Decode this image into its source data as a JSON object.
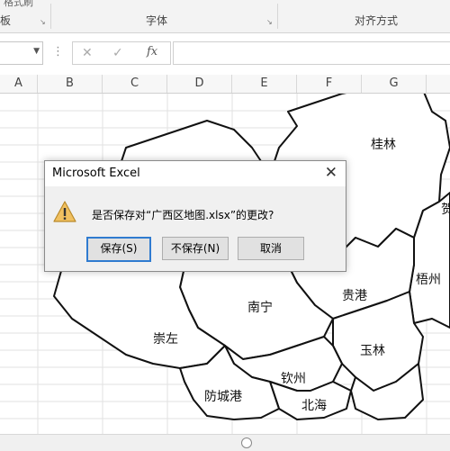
{
  "ribbon": {
    "cut_label": "格式刷",
    "group_left": "板",
    "group_font": "字体",
    "group_align": "对齐方式"
  },
  "formula_bar": {
    "cancel_icon": "✕",
    "enter_icon": "✓",
    "fx_label": "fx",
    "value": ""
  },
  "columns": [
    "A",
    "B",
    "C",
    "D",
    "E",
    "F",
    "G"
  ],
  "map": {
    "regions": [
      "桂林",
      "梧州",
      "贵港",
      "玉林",
      "南宁",
      "崇左",
      "钦州",
      "北海",
      "防城港",
      "贺"
    ]
  },
  "dialog": {
    "title": "Microsoft Excel",
    "close_icon": "✕",
    "message": "是否保存对“广西区地图.xlsx”的更改?",
    "buttons": {
      "save": "保存(S)",
      "dont_save": "不保存(N)",
      "cancel": "取消"
    }
  },
  "icons": {
    "warning": "warning-icon",
    "dropdown": "chevron-down-icon"
  }
}
